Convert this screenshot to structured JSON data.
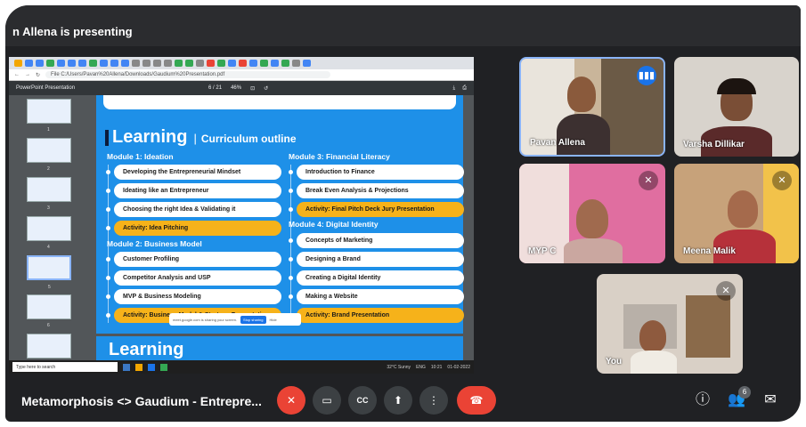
{
  "presenting_label": "n Allena is presenting",
  "browser": {
    "url": "File  C:/Users/Pavan%20Allena/Downloads/Gaudium%20Presentation.pdf",
    "pdf_title": "PowerPoint Presentation",
    "page": "6 / 21",
    "zoom": "46%"
  },
  "thumbnails": [
    "1",
    "2",
    "3",
    "4",
    "5",
    "6",
    "7"
  ],
  "slide": {
    "title": "Learning",
    "subtitle": "Curriculum outline",
    "modules_left": [
      {
        "title": "Module 1: Ideation",
        "items": [
          {
            "text": "Developing the Entrepreneurial Mindset",
            "activity": false
          },
          {
            "text": "Ideating like an Entrepreneur",
            "activity": false
          },
          {
            "text": "Choosing the right Idea & Validating it",
            "activity": false
          },
          {
            "text": "Activity: Idea Pitching",
            "activity": true
          }
        ]
      },
      {
        "title": "Module 2: Business Model",
        "items": [
          {
            "text": "Customer Profiling",
            "activity": false
          },
          {
            "text": "Competitor Analysis and USP",
            "activity": false
          },
          {
            "text": "MVP & Business Modeling",
            "activity": false
          },
          {
            "text": "Activity: Business Model & Strategy Presentation",
            "activity": true
          }
        ]
      }
    ],
    "modules_right": [
      {
        "title": "Module 3: Financial Literacy",
        "items": [
          {
            "text": "Introduction to Finance",
            "activity": false
          },
          {
            "text": "Break Even Analysis & Projections",
            "activity": false
          },
          {
            "text": "Activity: Final Pitch Deck Jury Presentation",
            "activity": true
          }
        ]
      },
      {
        "title": "Module 4: Digital Identity",
        "items": [
          {
            "text": "Concepts of Marketing",
            "activity": false
          },
          {
            "text": "Designing a Brand",
            "activity": false
          },
          {
            "text": "Creating a Digital Identity",
            "activity": false
          },
          {
            "text": "Making a Website",
            "activity": false
          },
          {
            "text": "Activity: Brand Presentation",
            "activity": true
          }
        ]
      }
    ],
    "next_title": "Learning"
  },
  "share_toast": {
    "text": "meet.google.com is sharing your screen.",
    "stop": "Stop sharing",
    "hide": "Hide"
  },
  "taskbar": {
    "search": "Type here to search",
    "weather": "32°C  Sunny",
    "lang": "ENG",
    "time": "10:21",
    "date": "01-02-2022"
  },
  "participants": [
    {
      "name": "Pavan Allena",
      "speaking": true
    },
    {
      "name": "Varsha Dillikar",
      "muted": false
    },
    {
      "name": "MYP C",
      "muted": true
    },
    {
      "name": "Meena Malik",
      "muted": true
    },
    {
      "name": "You",
      "muted": true
    }
  ],
  "meeting_name": "Metamorphosis <> Gaudium - Entrepre...",
  "participant_count": "6",
  "colors": {
    "slide_blue": "#1e90e8",
    "activity": "#f6b21a",
    "end_call": "#ea4335",
    "bar_bg": "#202124"
  }
}
